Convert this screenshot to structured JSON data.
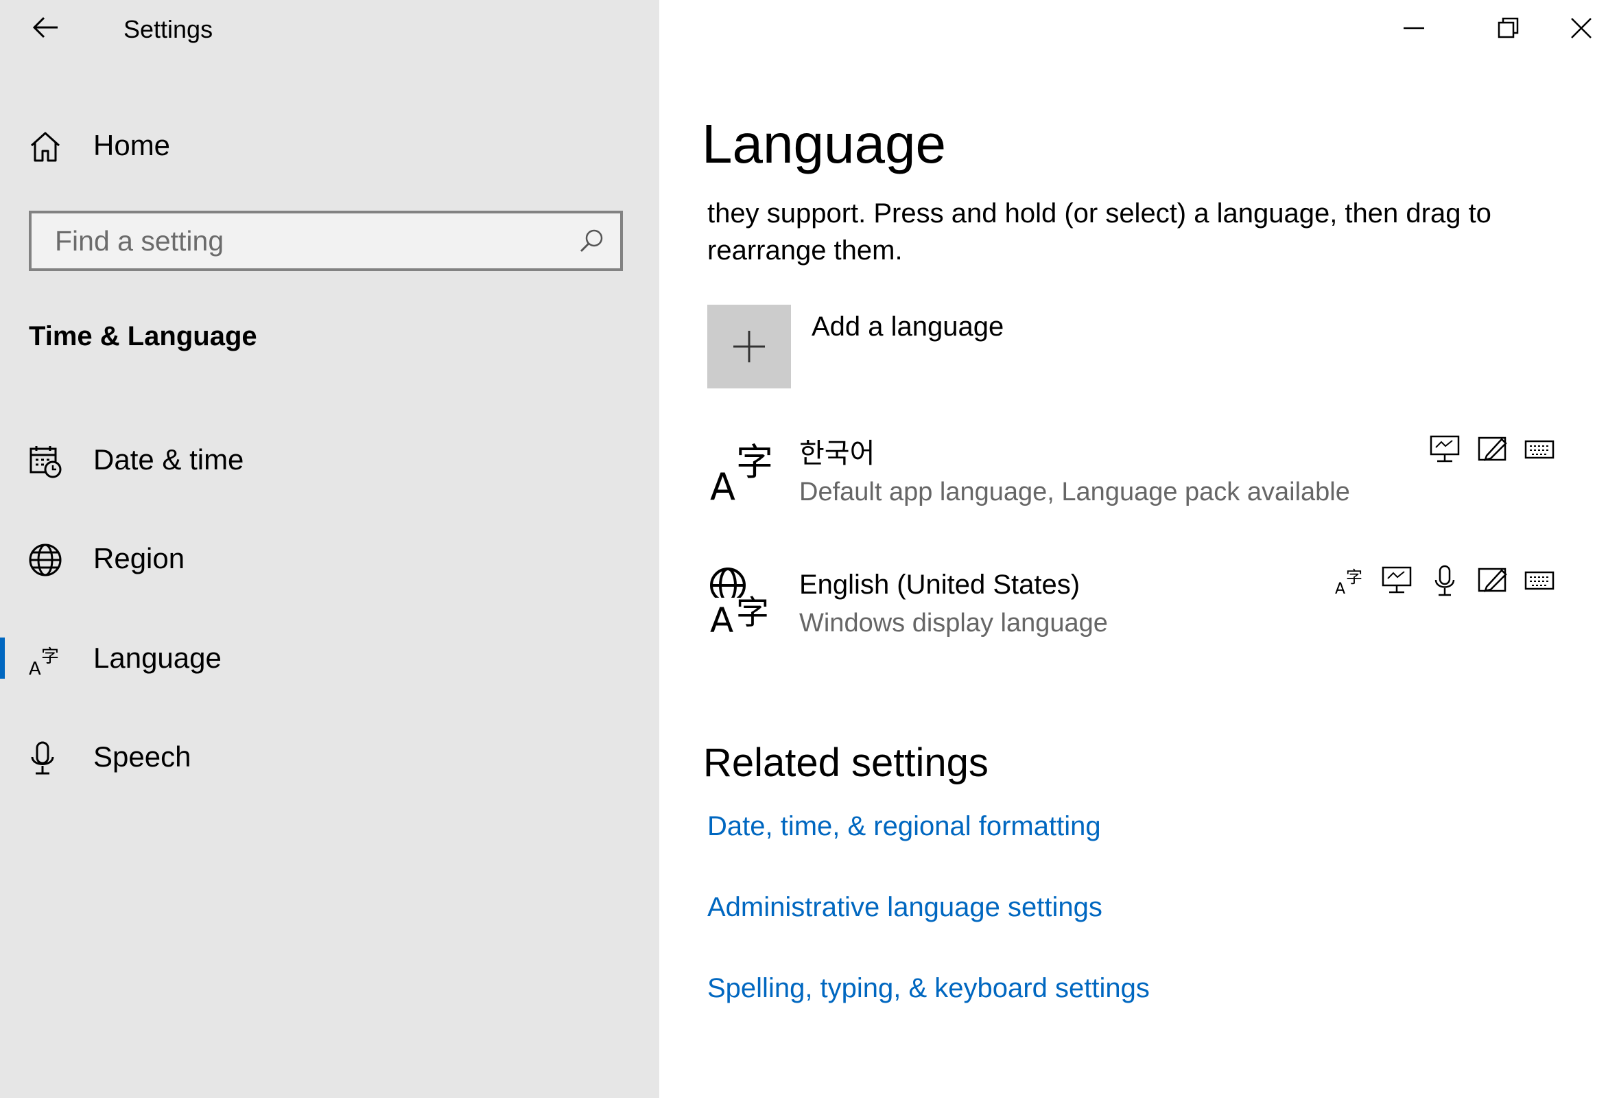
{
  "window": {
    "app_title": "Settings",
    "controls": {
      "minimize": "minimize-icon",
      "restore": "restore-icon",
      "close": "close-icon"
    }
  },
  "sidebar": {
    "home_label": "Home",
    "search_placeholder": "Find a setting",
    "section_title": "Time & Language",
    "items": [
      {
        "label": "Date & time",
        "icon": "calendar-clock-icon",
        "selected": false
      },
      {
        "label": "Region",
        "icon": "globe-icon",
        "selected": false
      },
      {
        "label": "Language",
        "icon": "language-icon",
        "selected": true
      },
      {
        "label": "Speech",
        "icon": "microphone-icon",
        "selected": false
      }
    ]
  },
  "main": {
    "title": "Language",
    "description": "they support. Press and hold (or select) a language, then drag to rearrange them.",
    "add_language_label": "Add a language",
    "languages": [
      {
        "name": "한국어",
        "status": "Default app language, Language pack available",
        "icon": "language-icon",
        "features": [
          "display-language-icon",
          "handwriting-icon",
          "keyboard-icon"
        ]
      },
      {
        "name": "English (United States)",
        "status": "Windows display language",
        "icon": "windows-display-language-icon",
        "features": [
          "language-pack-icon",
          "display-language-icon",
          "speech-icon",
          "handwriting-icon",
          "keyboard-icon"
        ]
      }
    ],
    "related_title": "Related settings",
    "related_links": [
      "Date, time, & regional formatting",
      "Administrative language settings",
      "Spelling, typing, & keyboard settings"
    ]
  },
  "colors": {
    "sidebar_bg": "#e6e6e6",
    "accent": "#0067c0",
    "link": "#0067c0",
    "add_tile": "#cccccc",
    "secondary_text": "#666666"
  }
}
